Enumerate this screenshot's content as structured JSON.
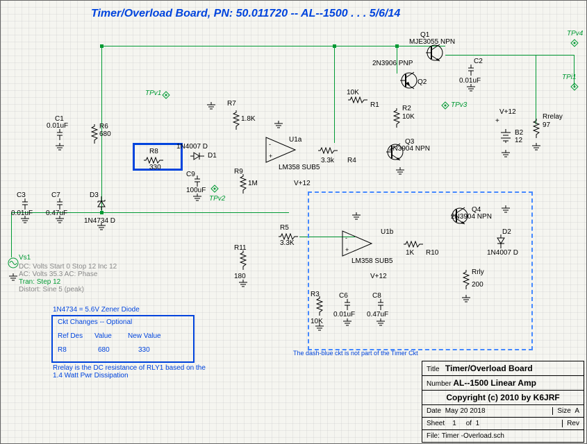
{
  "header": {
    "title": "Timer/Overload Board, PN: 50.011720  --  AL--1500 . . . 5/6/14"
  },
  "tp": {
    "v1": "TPv1",
    "v2": "TPv2",
    "v3": "TPv3",
    "v4": "TPv4",
    "i1": "TPi1"
  },
  "comp": {
    "C1": {
      "ref": "C1",
      "val": "0.01uF"
    },
    "C2": {
      "ref": "C2",
      "val": "0.01uF"
    },
    "C3": {
      "ref": "C3",
      "val": "0.01uF"
    },
    "C6": {
      "ref": "C6",
      "val": "0.01uF"
    },
    "C7": {
      "ref": "C7",
      "val": "0.47uF"
    },
    "C8": {
      "ref": "C8",
      "val": "0.47uF"
    },
    "C9": {
      "ref": "C9",
      "val": "100uF"
    },
    "R1": {
      "ref": "R1",
      "val": "10K"
    },
    "R2": {
      "ref": "R2",
      "val": "10K"
    },
    "R3": {
      "ref": "R3",
      "val": "10K"
    },
    "R4": {
      "ref": "R4",
      "val": "3.3k"
    },
    "R5": {
      "ref": "R5",
      "val": "3.3K"
    },
    "R6": {
      "ref": "R6",
      "val": "680"
    },
    "R7": {
      "ref": "R7",
      "val": "1.8K"
    },
    "R8": {
      "ref": "R8",
      "val": "330"
    },
    "R9": {
      "ref": "R9",
      "val": "1M"
    },
    "R10": {
      "ref": "R10",
      "val": "1K"
    },
    "R11": {
      "ref": "R11",
      "val": "180"
    },
    "Rrly": {
      "ref": "Rrly",
      "val": "200"
    },
    "Rrelay": {
      "ref": "Rrelay",
      "val": "97"
    },
    "D1": {
      "ref": "D1",
      "val": "1N4007 D"
    },
    "D2": {
      "ref": "D2",
      "val": "1N4007 D"
    },
    "D3": {
      "ref": "D3",
      "val": "1N4734 D"
    },
    "Q1": {
      "ref": "Q1",
      "val": "MJE3055 NPN"
    },
    "Q2": {
      "ref": "Q2",
      "val": "2N3906 PNP"
    },
    "Q3": {
      "ref": "Q3",
      "val": "2N3904 NPN"
    },
    "Q4": {
      "ref": "Q4",
      "val": "2N3904 NPN"
    },
    "U1a": {
      "ref": "U1a",
      "val": "LM358 SUB5"
    },
    "U1b": {
      "ref": "U1b",
      "val": "LM358 SUB5"
    },
    "B2": {
      "ref": "B2",
      "val": "12"
    },
    "Vs1": {
      "ref": "Vs1"
    },
    "v12": {
      "label": "V+12"
    }
  },
  "sim": {
    "dc": "DC: Volts Start 0 Stop 12 Inc 12",
    "ac": "AC: Volts 35.3 AC: Phase",
    "tran": "Tran: Step  12",
    "dist": "Distort: Sine  5 (peak)"
  },
  "notes": {
    "zener": "1N4734 = 5.6V Zener Diode",
    "changes_hdr": "Ckt Changes -- Optional",
    "col1": "Ref Des",
    "col2": "Value",
    "col3": "New Value",
    "row_r8_ref": "R8",
    "row_r8_val": "680",
    "row_r8_new": "330",
    "rrelay": "Rrelay is the DC resistance of RLY1 based on the 1.4 Watt Pwr Dissipation",
    "dashnote": "The dash-blue ckt is not part of the Timer Ckt"
  },
  "titleblock": {
    "title_lbl": "Title",
    "title": "Timer/Overload Board",
    "num_lbl": "Number",
    "num": "AL--1500 Linear Amp",
    "copy": "Copyright (c) 2010 by K6JRF",
    "date_lbl": "Date",
    "date": "May 20 2018",
    "size_lbl": "Size",
    "size": "A",
    "sheet_lbl": "Sheet",
    "sheet_n": "1",
    "sheet_of": "of",
    "sheet_t": "1",
    "rev_lbl": "Rev",
    "file_lbl": "File:",
    "file": "Timer -Overload.sch"
  }
}
